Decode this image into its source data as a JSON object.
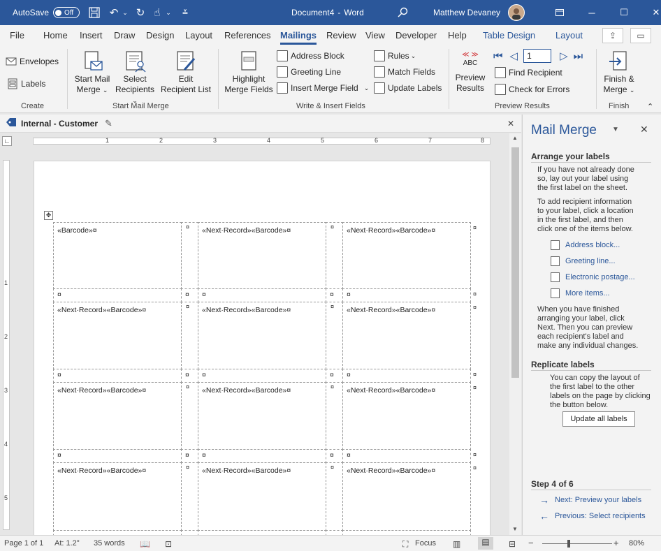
{
  "titlebar": {
    "autosave_label": "AutoSave",
    "autosave_state": "Off",
    "document_title": "Document4",
    "separator": "-",
    "app_name": "Word",
    "user_name": "Matthew Devaney"
  },
  "tabs": [
    "File",
    "Home",
    "Insert",
    "Draw",
    "Design",
    "Layout",
    "References",
    "Mailings",
    "Review",
    "View",
    "Developer",
    "Help",
    "Table Design",
    "Layout"
  ],
  "ribbon": {
    "create": {
      "envelopes": "Envelopes",
      "labels": "Labels",
      "group": "Create"
    },
    "start_mail_merge": {
      "start_line1": "Start Mail",
      "start_line2": "Merge",
      "select_line1": "Select",
      "select_line2": "Recipients",
      "edit_line1": "Edit",
      "edit_line2": "Recipient List",
      "group": "Start Mail Merge"
    },
    "write_insert": {
      "highlight_line1": "Highlight",
      "highlight_line2": "Merge Fields",
      "address_block": "Address Block",
      "greeting_line": "Greeting Line",
      "insert_merge_field": "Insert Merge Field",
      "rules": "Rules",
      "match_fields": "Match Fields",
      "update_labels": "Update Labels",
      "group": "Write & Insert Fields"
    },
    "preview": {
      "abc": "ABC",
      "preview_line1": "Preview",
      "preview_line2": "Results",
      "record_value": "1",
      "find_recipient": "Find Recipient",
      "check_errors": "Check for Errors",
      "group": "Preview Results"
    },
    "finish": {
      "finish_line1": "Finish &",
      "finish_line2": "Merge",
      "group": "Finish"
    }
  },
  "sensitivity": "Internal - Customer",
  "ruler": {
    "h_numbers": [
      "1",
      "2",
      "3",
      "4",
      "5",
      "6",
      "7",
      "8"
    ],
    "v_numbers": [
      "1",
      "2",
      "3",
      "4",
      "5"
    ]
  },
  "document": {
    "first_cell": "«Barcode»¤",
    "next_cell": "«Next·Record»«Barcode»¤",
    "end_mark": "¤"
  },
  "pane": {
    "title": "Mail Merge",
    "arrange_heading": "Arrange your labels",
    "arrange_p1": [
      "If you have not already done",
      "so, lay out your label using",
      "the first label on the sheet."
    ],
    "arrange_p2": [
      "To add recipient information",
      "to your label, click a location",
      "in the first label, and then",
      "click one of the items below."
    ],
    "links": [
      "Address block...",
      "Greeting line...",
      "Electronic postage...",
      "More items..."
    ],
    "arrange_p3": [
      "When you have finished",
      "arranging your label, click",
      "Next. Then you can preview",
      "each recipient's label and",
      "make any individual changes."
    ],
    "replicate_heading": "Replicate labels",
    "replicate_p": [
      "You can copy the layout of",
      "the first label to the other",
      "labels on the page by clicking",
      "the button below."
    ],
    "update_button": "Update all labels",
    "step": "Step 4 of 6",
    "next": "Next: Preview your labels",
    "previous": "Previous: Select recipients"
  },
  "status": {
    "page": "Page 1 of 1",
    "at": "At: 1.2\"",
    "words": "35 words",
    "focus": "Focus",
    "zoom": "80%"
  }
}
